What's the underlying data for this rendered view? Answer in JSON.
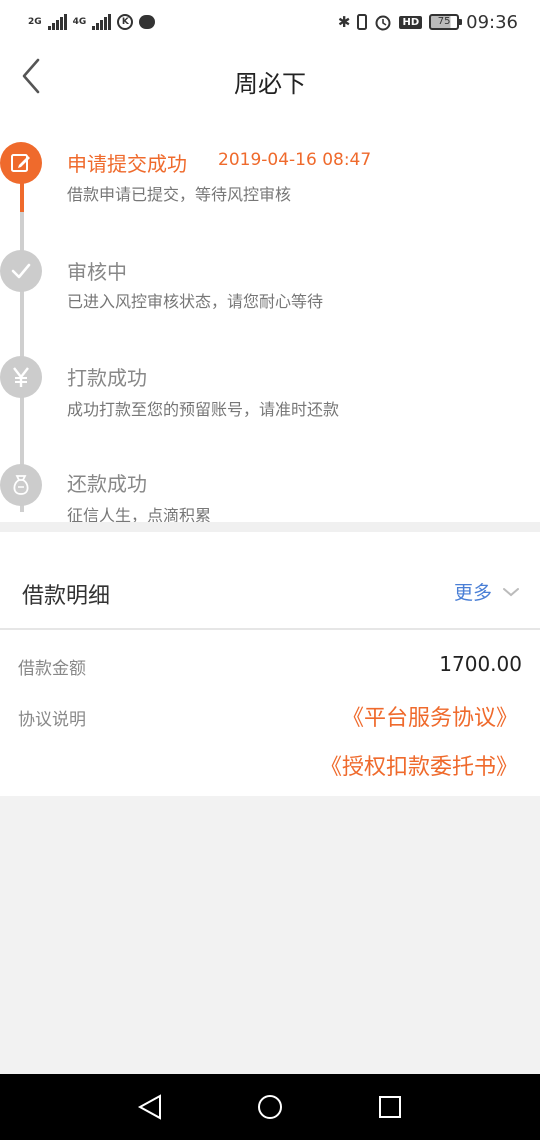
{
  "status_bar": {
    "net1": "2G",
    "net2": "4G",
    "k_badge": "K",
    "hd": "HD",
    "battery": "75",
    "time": "09:36",
    "icons": [
      "signal-icon",
      "k-icon",
      "message-icon",
      "bluetooth-icon",
      "vibrate-icon",
      "alarm-icon",
      "battery-icon"
    ]
  },
  "header": {
    "title": "周必下",
    "back_icon": "chevron-left-icon"
  },
  "steps": [
    {
      "title": "申请提交成功",
      "time": "2019-04-16 08:47",
      "desc": "借款申请已提交，等待风控审核",
      "status": "active",
      "icon": "edit-icon"
    },
    {
      "title": "审核中",
      "desc": "已进入风控审核状态，请您耐心等待",
      "status": "pending",
      "icon": "check-icon"
    },
    {
      "title": "打款成功",
      "desc": "成功打款至您的预留账号，请准时还款",
      "status": "pending",
      "icon": "yuan-icon"
    },
    {
      "title": "还款成功",
      "desc": "征信人生，点滴积累",
      "status": "pending",
      "icon": "money-bag-icon"
    }
  ],
  "details": {
    "title": "借款明细",
    "more_label": "更多",
    "amount_label": "借款金额",
    "amount_value": "1700.00",
    "agreement_label": "协议说明",
    "agreements": [
      "《平台服务协议》",
      "《授权扣款委托书》"
    ]
  },
  "colors": {
    "accent": "#ef6a2c",
    "link": "#4a7fd6",
    "pending": "#cccccc"
  }
}
